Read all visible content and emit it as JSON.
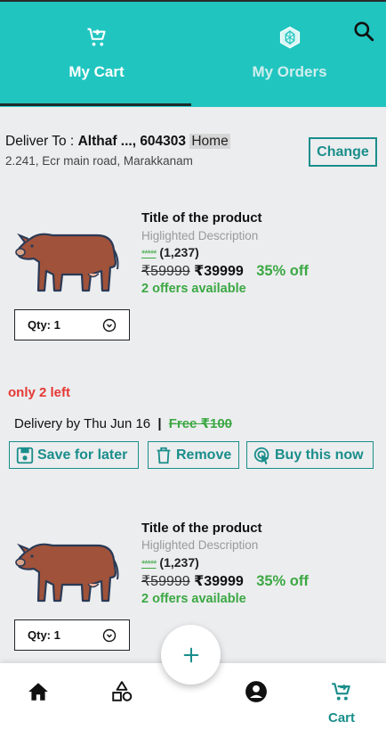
{
  "tabs": [
    {
      "label": "My Cart",
      "icon": "cart-icon",
      "active": true
    },
    {
      "label": "My Orders",
      "icon": "orders-icon",
      "active": false
    }
  ],
  "header": {
    "search_icon": "search-icon",
    "accent": "#21c5c0"
  },
  "delivery": {
    "prefix": "Deliver To :",
    "name": "Althaf ..., 604303",
    "tag": "Home",
    "address": "2.241, Ecr main road, Marakkanam",
    "change_label": "Change"
  },
  "products": [
    {
      "title": "Title of the product",
      "description": "Higlighted Description",
      "stars": "*****",
      "reviews": "(1,237)",
      "mrp": "₹59999",
      "price": "₹39999",
      "discount": "35% off",
      "offers": "2 offers available",
      "qty": "Qty: 1"
    },
    {
      "title": "Title of the product",
      "description": "Higlighted Description",
      "stars": "*****",
      "reviews": "(1,237)",
      "mrp": "₹59999",
      "price": "₹39999",
      "discount": "35% off",
      "offers": "2 offers available",
      "qty": "Qty: 1"
    }
  ],
  "stock_note": "only 2 left",
  "delivery_info": {
    "text": "Delivery by Thu Jun 16",
    "separator": "|",
    "fee": "Free ₹100"
  },
  "actions": {
    "save": "Save for later",
    "remove": "Remove",
    "buy": "Buy this now"
  },
  "bottom_nav": {
    "items": [
      {
        "icon": "home-icon"
      },
      {
        "icon": "categories-icon"
      },
      {
        "icon": "account-icon"
      },
      {
        "icon": "cart-icon",
        "label": "Cart",
        "active": true
      }
    ],
    "fab_icon": "plus-icon"
  },
  "colors": {
    "teal": "#1a8e8b",
    "green": "#3ba843",
    "red": "#e53935"
  }
}
